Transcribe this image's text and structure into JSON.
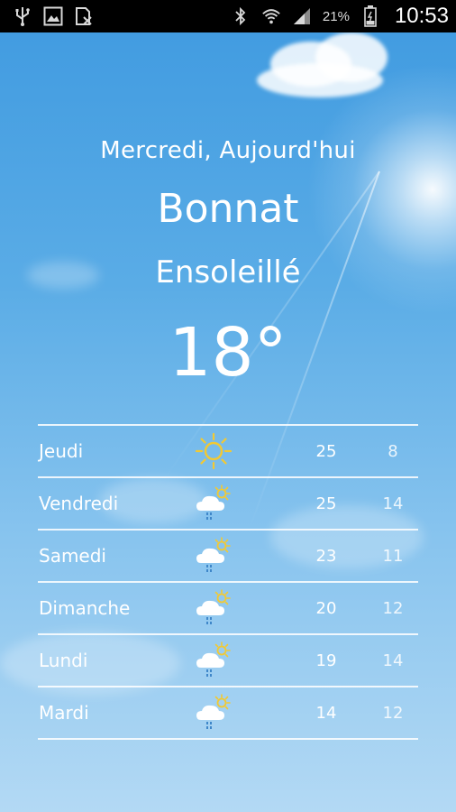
{
  "status_bar": {
    "left_icons": [
      "usb-icon",
      "image-icon",
      "sim-off-icon"
    ],
    "right_icons": [
      "bluetooth-icon",
      "wifi-icon",
      "signal-icon",
      "battery-icon"
    ],
    "battery_percent": "21%",
    "time": "10:53"
  },
  "current": {
    "date_label": "Mercredi, Aujourd'hui",
    "city": "Bonnat",
    "condition": "Ensoleillé",
    "temperature": "18°"
  },
  "forecast": [
    {
      "day": "Jeudi",
      "icon": "sun-icon",
      "max": "25",
      "min": "8"
    },
    {
      "day": "Vendredi",
      "icon": "rain-shower-icon",
      "max": "25",
      "min": "14"
    },
    {
      "day": "Samedi",
      "icon": "rain-shower-icon",
      "max": "23",
      "min": "11"
    },
    {
      "day": "Dimanche",
      "icon": "rain-shower-icon",
      "max": "20",
      "min": "12"
    },
    {
      "day": "Lundi",
      "icon": "rain-shower-icon",
      "max": "19",
      "min": "14"
    },
    {
      "day": "Mardi",
      "icon": "rain-shower-icon",
      "max": "14",
      "min": "12"
    }
  ],
  "colors": {
    "sky_top": "#3f9ae0",
    "sky_bottom": "#b3d9f4",
    "sun_icon": "#f2c933",
    "rain_drops": "#3f87c9"
  }
}
